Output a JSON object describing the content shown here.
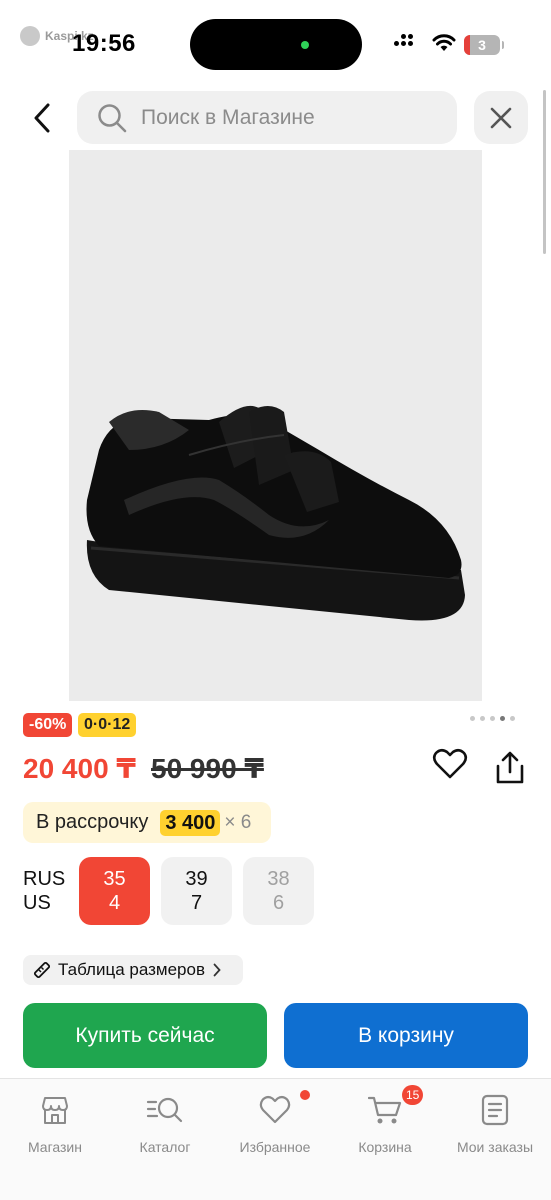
{
  "status_bar": {
    "app_back_label": "Kaspi.kz",
    "time": "19:56",
    "battery": "3"
  },
  "header": {
    "search_placeholder": "Поиск в Магазине"
  },
  "product": {
    "image_alt": "black velcro sneaker",
    "gallery": {
      "count": 5,
      "active": 3
    },
    "discount_badge": "-60%",
    "installment_badge": "0·0·12",
    "price": "20 400 ₸",
    "old_price": "50 990 ₸"
  },
  "installment": {
    "label": "В рассрочку",
    "amount": "3 400",
    "multiplier": "× 6"
  },
  "sizes": {
    "label_rus": "RUS",
    "label_us": "US",
    "options": [
      {
        "rus": "35",
        "us": "4",
        "state": "selected"
      },
      {
        "rus": "39",
        "us": "7",
        "state": "available"
      },
      {
        "rus": "38",
        "us": "6",
        "state": "disabled"
      }
    ]
  },
  "size_table": {
    "label": "Таблица размеров"
  },
  "actions": {
    "buy_now": "Купить сейчас",
    "add_to_cart": "В корзину"
  },
  "tabbar": {
    "items": [
      {
        "label": "Магазин",
        "icon": "store-icon"
      },
      {
        "label": "Каталог",
        "icon": "catalog-search-icon"
      },
      {
        "label": "Избранное",
        "icon": "heart-icon",
        "dot": true
      },
      {
        "label": "Корзина",
        "icon": "cart-icon",
        "badge": "15"
      },
      {
        "label": "Мои заказы",
        "icon": "orders-icon"
      }
    ]
  },
  "colors": {
    "accent_red": "#f14635",
    "buy_green": "#1fa64f",
    "cart_blue": "#0f6fd1",
    "installment_yellow": "#ffd12f"
  }
}
